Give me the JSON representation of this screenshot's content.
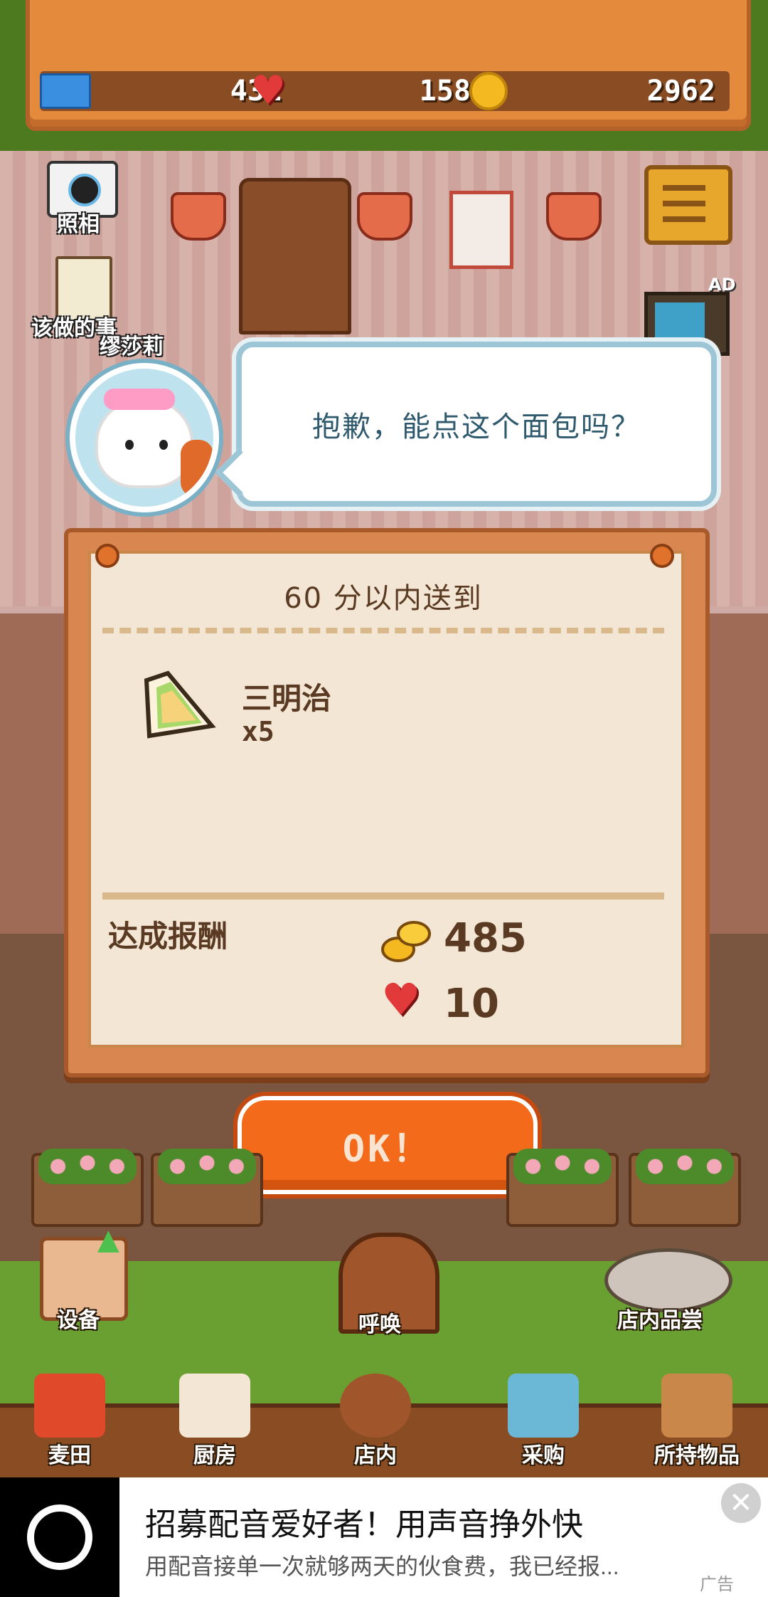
{
  "hud": {
    "tickets": "431",
    "hearts": "1583",
    "coins": "2962"
  },
  "scene_buttons": {
    "camera_label": "照相",
    "todo_label": "该做的事",
    "menu_icon": "hamburger-menu-icon",
    "tv_ad_badge": "AD"
  },
  "customer": {
    "name": "缪莎莉",
    "speech": "抱歉，能点这个面包吗？"
  },
  "order": {
    "deadline": "60 分以内送到",
    "item_name": "三明治",
    "item_qty": "x5",
    "reward_label": "达成报酬",
    "reward_coins": "485",
    "reward_hearts": "10",
    "ok_label": "OK！"
  },
  "lower_controls": {
    "equipment_label": "设备",
    "call_label": "呼唤",
    "tasting_label": "店内品尝"
  },
  "bottom_nav": [
    {
      "label": "麦田",
      "icon": "wheat-field-icon"
    },
    {
      "label": "厨房",
      "icon": "kitchen-icon"
    },
    {
      "label": "店内",
      "icon": "store-icon"
    },
    {
      "label": "采购",
      "icon": "purchase-icon"
    },
    {
      "label": "所持物品",
      "icon": "inventory-box-icon"
    }
  ],
  "ad": {
    "title": "招募配音爱好者！用声音挣外快",
    "description": "用配音接单一次就够两天的伙食费，我已经报...",
    "tag": "广告",
    "close_glyph": "✕"
  },
  "colors": {
    "accent_orange": "#f26a1a",
    "board_orange": "#e48a3c",
    "heart_red": "#e23a3a",
    "coin_gold": "#f4b820",
    "bubble_text": "#2f5a6e"
  }
}
